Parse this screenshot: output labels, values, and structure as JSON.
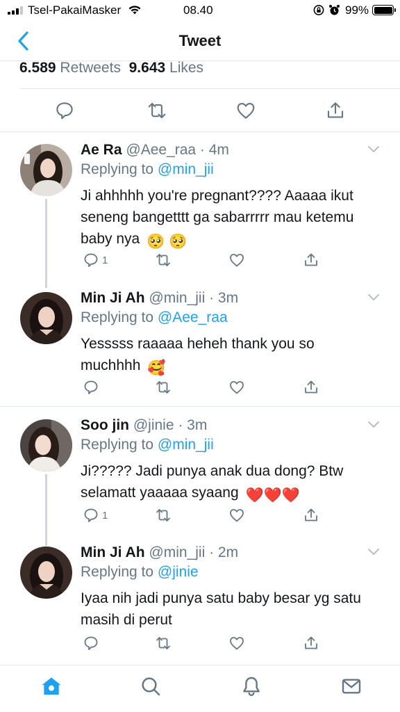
{
  "status_bar": {
    "carrier": "Tsel-PakaiMasker",
    "time": "08.40",
    "battery": "99%"
  },
  "header": {
    "title": "Tweet",
    "back_icon": "chevron-left-icon"
  },
  "stats": {
    "retweets_count": "6.589",
    "retweets_label": "Retweets",
    "likes_count": "9.643",
    "likes_label": "Likes"
  },
  "colors": {
    "accent": "#1da1f2",
    "muted": "#657786",
    "divider": "#e1e8ed",
    "heart": "#e0245e"
  },
  "replies": [
    {
      "name": "Ae Ra",
      "handle_time": "@Aee_raa · 4m",
      "replying_prefix": "Replying to",
      "replying_to": "@min_jii",
      "text": "Ji ahhhhh you're pregnant???? Aaaaa ikut seneng bangetttt ga sabarrrrr mau ketemu baby nya",
      "emoji": "🥺 🥺",
      "reply_count": "1"
    },
    {
      "name": "Min Ji Ah",
      "handle_time": "@min_jii · 3m",
      "replying_prefix": "Replying to",
      "replying_to": "@Aee_raa",
      "text": "Yesssss raaaaa heheh thank you so muchhhh",
      "emoji": "🥰",
      "reply_count": ""
    },
    {
      "name": "Soo jin",
      "handle_time": "@jinie · 3m",
      "replying_prefix": "Replying to",
      "replying_to": "@min_jii",
      "text": "Ji????? Jadi punya anak dua dong? Btw selamatt yaaaaa syaang",
      "emoji": "❤️❤️❤️",
      "reply_count": "1"
    },
    {
      "name": "Min Ji Ah",
      "handle_time": "@min_jii · 2m",
      "replying_prefix": "Replying to",
      "replying_to": "@jinie",
      "text": "Iyaa nih jadi punya satu baby besar yg satu masih di perut",
      "emoji": "",
      "reply_count": ""
    }
  ],
  "tab_bar": {
    "items": [
      "home-icon",
      "search-icon",
      "bell-icon",
      "mail-icon"
    ],
    "active": "home-icon"
  }
}
